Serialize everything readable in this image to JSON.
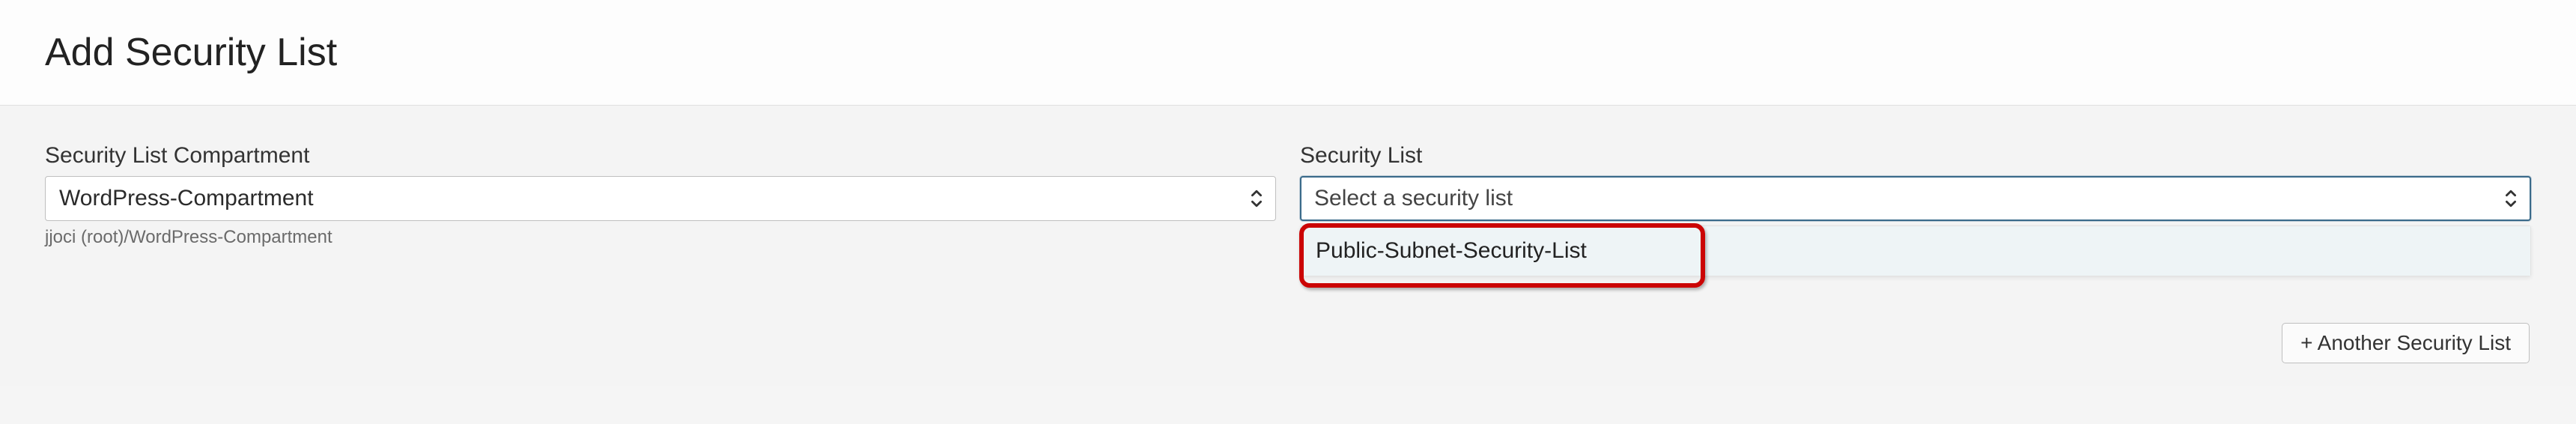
{
  "header": {
    "title": "Add Security List"
  },
  "compartment": {
    "label": "Security List Compartment",
    "value": "WordPress-Compartment",
    "breadcrumb": "jjoci (root)/WordPress-Compartment"
  },
  "securityList": {
    "label": "Security List",
    "placeholder": "Select a security list",
    "options": [
      "Public-Subnet-Security-List"
    ]
  },
  "actions": {
    "addAnother": "+ Another Security List"
  }
}
